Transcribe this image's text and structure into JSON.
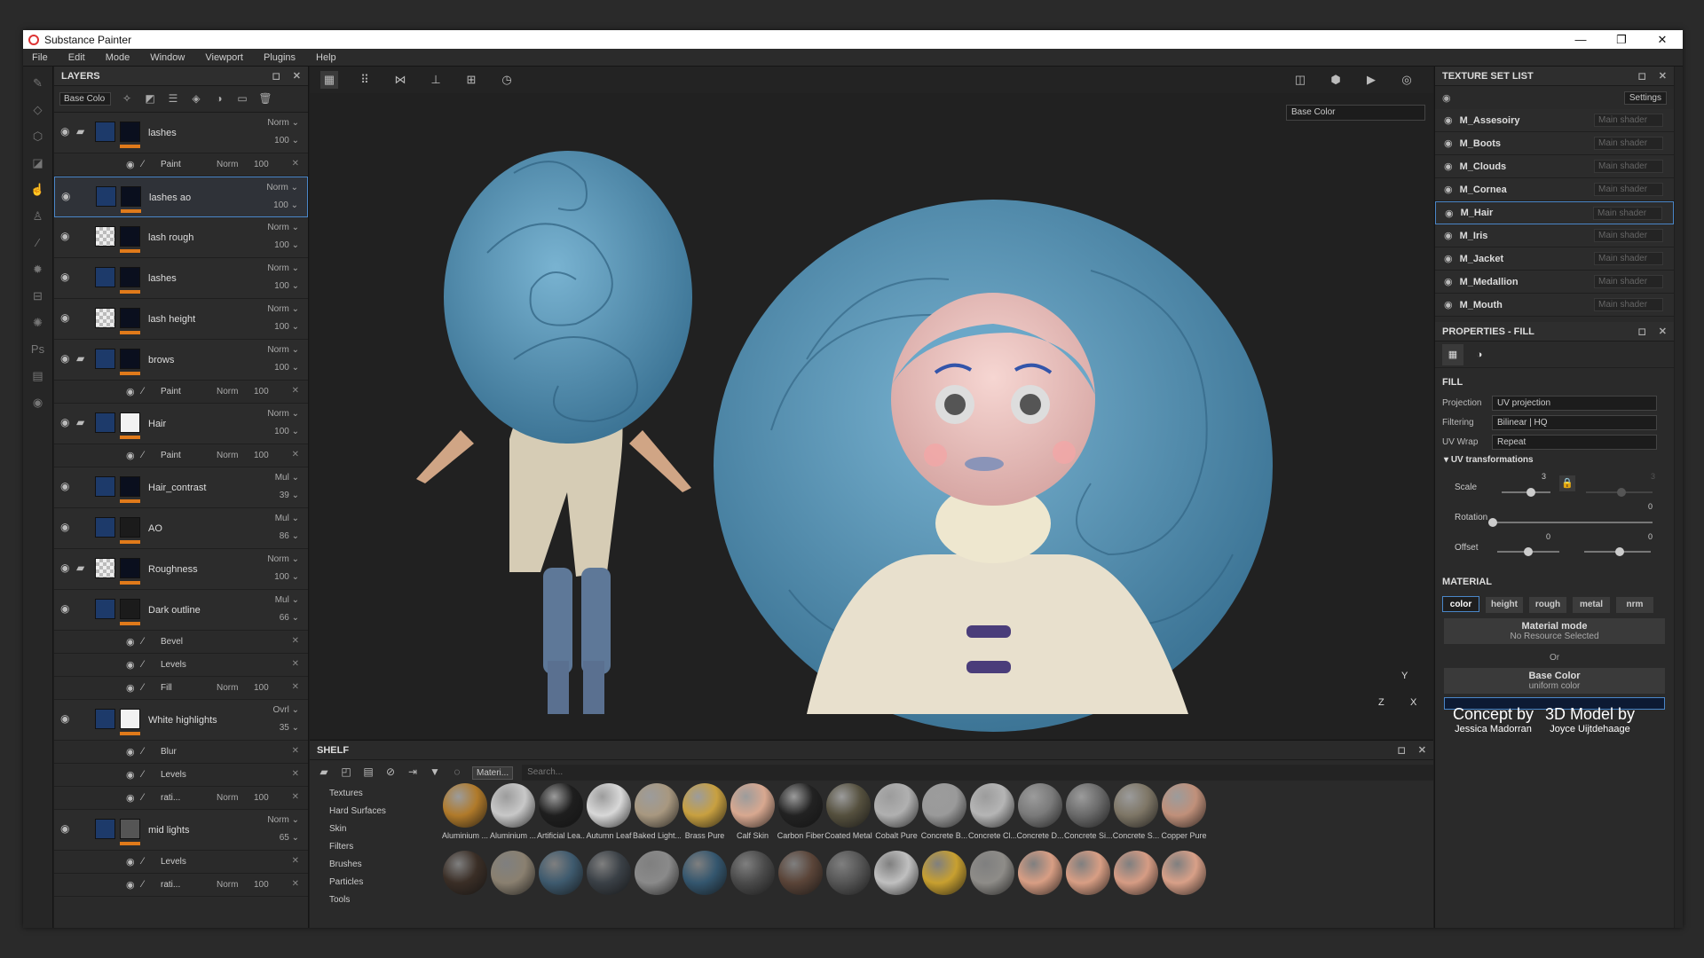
{
  "window": {
    "title": "Substance Painter",
    "controls": [
      "—",
      "❐",
      "✕"
    ]
  },
  "menu": [
    "File",
    "Edit",
    "Mode",
    "Window",
    "Viewport",
    "Plugins",
    "Help"
  ],
  "layers_panel": {
    "title": "LAYERS",
    "channel_select": "Base Colo",
    "rows": [
      {
        "kind": "layer",
        "name": "lashes",
        "blend": "Norm",
        "opacity": "100",
        "folder": true,
        "t1": "",
        "t2": ""
      },
      {
        "kind": "sub",
        "name": "Paint",
        "blend": "Norm",
        "opacity": "100"
      },
      {
        "kind": "layer",
        "name": "lashes ao",
        "blend": "Norm",
        "opacity": "100",
        "selected": true
      },
      {
        "kind": "layer",
        "name": "lash rough",
        "blend": "Norm",
        "opacity": "100"
      },
      {
        "kind": "layer",
        "name": "lashes",
        "blend": "Norm",
        "opacity": "100"
      },
      {
        "kind": "layer",
        "name": "lash height",
        "blend": "Norm",
        "opacity": "100"
      },
      {
        "kind": "layer",
        "name": "brows",
        "blend": "Norm",
        "opacity": "100",
        "folder": true
      },
      {
        "kind": "sub",
        "name": "Paint",
        "blend": "Norm",
        "opacity": "100"
      },
      {
        "kind": "layer",
        "name": "Hair",
        "blend": "Norm",
        "opacity": "100",
        "folder": true
      },
      {
        "kind": "sub",
        "name": "Paint",
        "blend": "Norm",
        "opacity": "100"
      },
      {
        "kind": "layer",
        "name": "Hair_contrast",
        "blend": "Mul",
        "opacity": "39"
      },
      {
        "kind": "layer",
        "name": "AO",
        "blend": "Mul",
        "opacity": "86"
      },
      {
        "kind": "layer",
        "name": "Roughness",
        "blend": "Norm",
        "opacity": "100",
        "folder": true
      },
      {
        "kind": "layer",
        "name": "Dark outline",
        "blend": "Mul",
        "opacity": "66"
      },
      {
        "kind": "sub",
        "name": "Bevel",
        "blend": "",
        "opacity": ""
      },
      {
        "kind": "sub",
        "name": "Levels",
        "blend": "",
        "opacity": ""
      },
      {
        "kind": "sub",
        "name": "Fill",
        "blend": "Norm",
        "opacity": "100"
      },
      {
        "kind": "layer",
        "name": "White highlights",
        "blend": "Ovrl",
        "opacity": "35"
      },
      {
        "kind": "sub",
        "name": "Blur",
        "blend": "",
        "opacity": ""
      },
      {
        "kind": "sub",
        "name": "Levels",
        "blend": "",
        "opacity": ""
      },
      {
        "kind": "sub",
        "name": "rati...",
        "blend": "Norm",
        "opacity": "100"
      },
      {
        "kind": "layer",
        "name": "mid lights",
        "blend": "Norm",
        "opacity": "65"
      },
      {
        "kind": "sub",
        "name": "Levels",
        "blend": "",
        "opacity": ""
      },
      {
        "kind": "sub",
        "name": "rati...",
        "blend": "Norm",
        "opacity": "100"
      }
    ]
  },
  "viewport": {
    "channel": "Base Color",
    "axis_y": "Y",
    "axis_x": "X",
    "axis_z": "Z"
  },
  "shelf": {
    "title": "SHELF",
    "filter_tag": "Materi...",
    "search_placeholder": "Search...",
    "categories": [
      "Textures",
      "Hard Surfaces",
      "Skin",
      "Filters",
      "Brushes",
      "Particles",
      "Tools"
    ],
    "materials": [
      {
        "label": "Aluminium ...",
        "color": "#b07a2a"
      },
      {
        "label": "Aluminium ...",
        "color": "#c8c8c8"
      },
      {
        "label": "Artificial Lea...",
        "color": "#1e1e1e"
      },
      {
        "label": "Autumn Leaf",
        "color": "#d8d8d8"
      },
      {
        "label": "Baked Light...",
        "color": "#a89880"
      },
      {
        "label": "Brass Pure",
        "color": "#c8a040"
      },
      {
        "label": "Calf Skin",
        "color": "#d8a890"
      },
      {
        "label": "Carbon Fiber",
        "color": "#222222"
      },
      {
        "label": "Coated Metal",
        "color": "#55503e"
      },
      {
        "label": "Cobalt Pure",
        "color": "#b0b0b0"
      },
      {
        "label": "Concrete B...",
        "color": "#9a9a9a"
      },
      {
        "label": "Concrete Cl...",
        "color": "#b5b5b5"
      },
      {
        "label": "Concrete D...",
        "color": "#7a7a7a"
      },
      {
        "label": "Concrete Si...",
        "color": "#6a6a6a"
      },
      {
        "label": "Concrete S...",
        "color": "#7e7666"
      },
      {
        "label": "Copper Pure",
        "color": "#c0907a"
      }
    ],
    "materials_row2": [
      "#3a2e26",
      "#8a8070",
      "#3e5a6e",
      "#3a4046",
      "#8a8a8a",
      "#34566e",
      "#4a4a4a",
      "#5a4438",
      "#555555",
      "#c0c0c0",
      "#c8a030",
      "#8e8c88",
      "#d89e84",
      "#d89e84",
      "#d69c84",
      "#d8a088"
    ]
  },
  "texture_sets": {
    "title": "TEXTURE SET LIST",
    "settings": "Settings",
    "items": [
      {
        "name": "M_Assesoiry",
        "shader": "Main shader"
      },
      {
        "name": "M_Boots",
        "shader": "Main shader"
      },
      {
        "name": "M_Clouds",
        "shader": "Main shader"
      },
      {
        "name": "M_Cornea",
        "shader": "Main shader"
      },
      {
        "name": "M_Hair",
        "shader": "Main shader"
      },
      {
        "name": "M_Iris",
        "shader": "Main shader"
      },
      {
        "name": "M_Jacket",
        "shader": "Main shader"
      },
      {
        "name": "M_Medallion",
        "shader": "Main shader"
      },
      {
        "name": "M_Mouth",
        "shader": "Main shader"
      }
    ]
  },
  "properties": {
    "title": "PROPERTIES - FILL",
    "fill": "FILL",
    "projection_label": "Projection",
    "projection": "UV projection",
    "filtering_label": "Filtering",
    "filtering": "Bilinear | HQ",
    "uvwrap_label": "UV Wrap",
    "uvwrap": "Repeat",
    "uvt": "UV transformations",
    "scale_label": "Scale",
    "scale_a": "3",
    "scale_b": "3",
    "rotation_label": "Rotation",
    "rotation": "0",
    "offset_label": "Offset",
    "offset_a": "0",
    "offset_b": "0",
    "material": "MATERIAL",
    "channels": [
      "color",
      "height",
      "rough",
      "metal",
      "nrm"
    ],
    "mat_mode": "Material mode",
    "mat_mode_sub": "No Resource Selected",
    "or": "Or",
    "base_color": "Base Color",
    "base_color_sub": "uniform color",
    "base_color_value": "#0d1a33"
  },
  "credits": {
    "c1a": "Concept by",
    "c1b": "Jessica Madorran",
    "c2a": "3D Model by",
    "c2b": "Joyce Uijtdehaage"
  }
}
